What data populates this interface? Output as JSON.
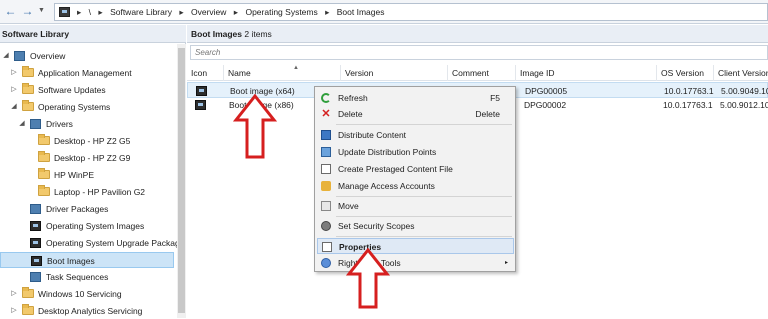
{
  "address_bar": {
    "back_icon": "back-arrow-icon",
    "forward_icon": "forward-arrow-icon",
    "dropdown_icon": "chevron-down-icon",
    "breadcrumbs": [
      "\\",
      "Software Library",
      "Overview",
      "Operating Systems",
      "Boot Images"
    ],
    "separator": "▸"
  },
  "left_pane": {
    "title": "Software Library",
    "tree": [
      {
        "label": "Overview",
        "icon": "overview-icon",
        "level": 0,
        "expander": "◢"
      },
      {
        "label": "Application Management",
        "icon": "folder-icon",
        "level": 1,
        "expander": "▷"
      },
      {
        "label": "Software Updates",
        "icon": "folder-icon",
        "level": 1,
        "expander": "▷"
      },
      {
        "label": "Operating Systems",
        "icon": "folder-icon",
        "level": 1,
        "expander": "◢"
      },
      {
        "label": "Drivers",
        "icon": "drivers-icon",
        "level": 2,
        "expander": "◢"
      },
      {
        "label": "Desktop - HP Z2 G5",
        "icon": "folder-icon",
        "level": 3,
        "expander": ""
      },
      {
        "label": "Desktop - HP Z2 G9",
        "icon": "folder-icon",
        "level": 3,
        "expander": ""
      },
      {
        "label": "HP WinPE",
        "icon": "folder-icon",
        "level": 3,
        "expander": ""
      },
      {
        "label": "Laptop - HP Pavilion G2",
        "icon": "folder-icon",
        "level": 3,
        "expander": ""
      },
      {
        "label": "Driver Packages",
        "icon": "package-icon",
        "level": 2,
        "expander": ""
      },
      {
        "label": "Operating System Images",
        "icon": "os-image-icon",
        "level": 2,
        "expander": ""
      },
      {
        "label": "Operating System Upgrade Package",
        "icon": "os-upgrade-icon",
        "level": 2,
        "expander": ""
      },
      {
        "label": "Boot Images",
        "icon": "boot-image-icon",
        "level": 2,
        "expander": "",
        "selected": true
      },
      {
        "label": "Task Sequences",
        "icon": "task-sequence-icon",
        "level": 2,
        "expander": ""
      },
      {
        "label": "Windows 10 Servicing",
        "icon": "folder-icon",
        "level": 1,
        "expander": "▷"
      },
      {
        "label": "Desktop Analytics Servicing",
        "icon": "folder-icon",
        "level": 1,
        "expander": "▷"
      }
    ]
  },
  "right_pane": {
    "header_title": "Boot Images",
    "header_count": "2 items",
    "search_placeholder": "Search",
    "columns": [
      "Icon",
      "Name",
      "Version",
      "Comment",
      "Image ID",
      "OS Version",
      "Client Version"
    ],
    "rows": [
      {
        "icon": "boot-image-icon",
        "name": "Boot image (x64)",
        "version": "",
        "comment": "",
        "image_id": "DPG00005",
        "os_version": "10.0.17763.1",
        "client_version": "5.00.9049.10",
        "selected": true
      },
      {
        "icon": "boot-image-icon",
        "name": "Boot image (x86)",
        "version": "",
        "comment": "",
        "image_id": "DPG00002",
        "os_version": "10.0.17763.1",
        "client_version": "5.00.9012.10",
        "selected": false
      }
    ]
  },
  "context_menu": {
    "items": [
      {
        "label": "Refresh",
        "shortcut": "F5",
        "icon": "refresh-icon"
      },
      {
        "label": "Delete",
        "shortcut": "Delete",
        "icon": "delete-icon"
      },
      {
        "label": "Distribute Content",
        "shortcut": "",
        "icon": "distribute-content-icon"
      },
      {
        "label": "Update Distribution Points",
        "shortcut": "",
        "icon": "update-distribution-points-icon"
      },
      {
        "label": "Create Prestaged Content File",
        "shortcut": "",
        "icon": "prestaged-content-icon"
      },
      {
        "label": "Manage Access Accounts",
        "shortcut": "",
        "icon": "access-accounts-icon"
      },
      {
        "label": "Move",
        "shortcut": "",
        "icon": "move-icon"
      },
      {
        "label": "Set Security Scopes",
        "shortcut": "",
        "icon": "security-scopes-icon"
      },
      {
        "label": "Properties",
        "shortcut": "",
        "icon": "properties-icon",
        "highlighted": true
      },
      {
        "label": "Right Click Tools",
        "shortcut": "",
        "icon": "right-click-tools-icon",
        "submenu": "▸"
      }
    ]
  },
  "annotation_color": "#d61f1f"
}
